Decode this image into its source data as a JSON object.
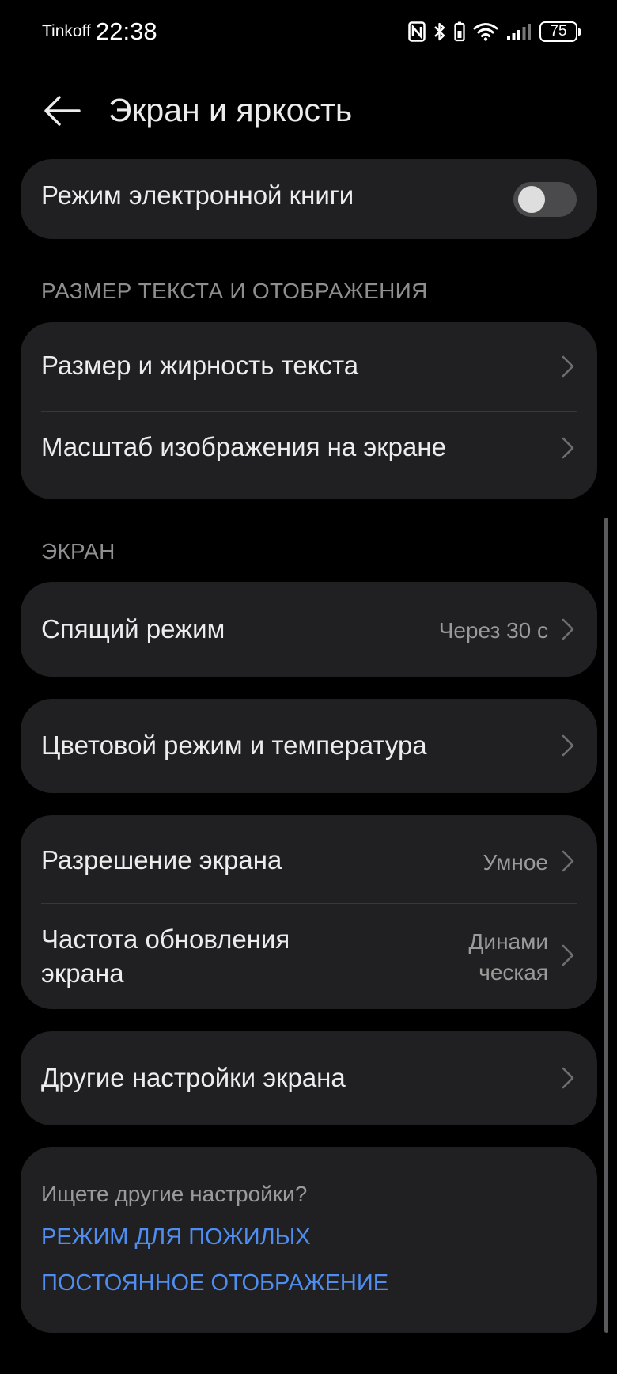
{
  "status_bar": {
    "carrier": "Tinkoff",
    "time": "22:38",
    "battery": "75",
    "icons": [
      "nfc-icon",
      "bluetooth-icon",
      "vibrate-icon",
      "wifi-icon",
      "signal-icon",
      "battery-icon"
    ]
  },
  "header": {
    "title": "Экран и яркость",
    "back_icon": "arrow-left-icon"
  },
  "ebook": {
    "label": "Режим электронной книги",
    "enabled": false
  },
  "section_text_display": {
    "title": "РАЗМЕР ТЕКСТА И ОТОБРАЖЕНИЯ",
    "items": [
      {
        "label": "Размер и жирность текста"
      },
      {
        "label": "Масштаб изображения на экране"
      }
    ]
  },
  "section_screen": {
    "title": "ЭКРАН",
    "sleep": {
      "label": "Спящий режим",
      "value": "Через 30 с"
    },
    "color": {
      "label": "Цветовой режим и температура"
    },
    "resolution": {
      "label": "Разрешение экрана",
      "value": "Умное"
    },
    "refresh_rate": {
      "label_line1": "Частота обновления",
      "label_line2": "экрана",
      "value_line1": "Динами",
      "value_line2": "ческая"
    },
    "other": {
      "label": "Другие настройки экрана"
    }
  },
  "hint": {
    "text": "Ищете другие настройки?",
    "links": [
      "РЕЖИМ ДЛЯ ПОЖИЛЫХ",
      "ПОСТОЯННОЕ ОТОБРАЖЕНИЕ"
    ]
  },
  "colors": {
    "background": "#000000",
    "card": "#202022",
    "link": "#4f8ef0",
    "secondary_text": "#9a9a9a"
  }
}
